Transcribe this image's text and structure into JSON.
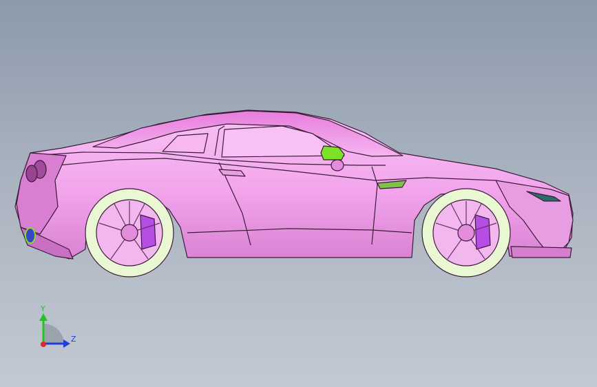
{
  "viewport": {
    "model": {
      "body_color": "#f3a9ee",
      "line_color": "#3b1a38",
      "tire_color": "#e9f7d2",
      "rim_color": "#f2b7ee",
      "caliper_color": "#b64ee6",
      "mirror_color": "#7de225"
    },
    "triad": {
      "y_label": "Y",
      "z_label": "Z",
      "y_color": "#22c51f",
      "z_color": "#1f3fd6",
      "x_color": "#e0282a"
    }
  }
}
